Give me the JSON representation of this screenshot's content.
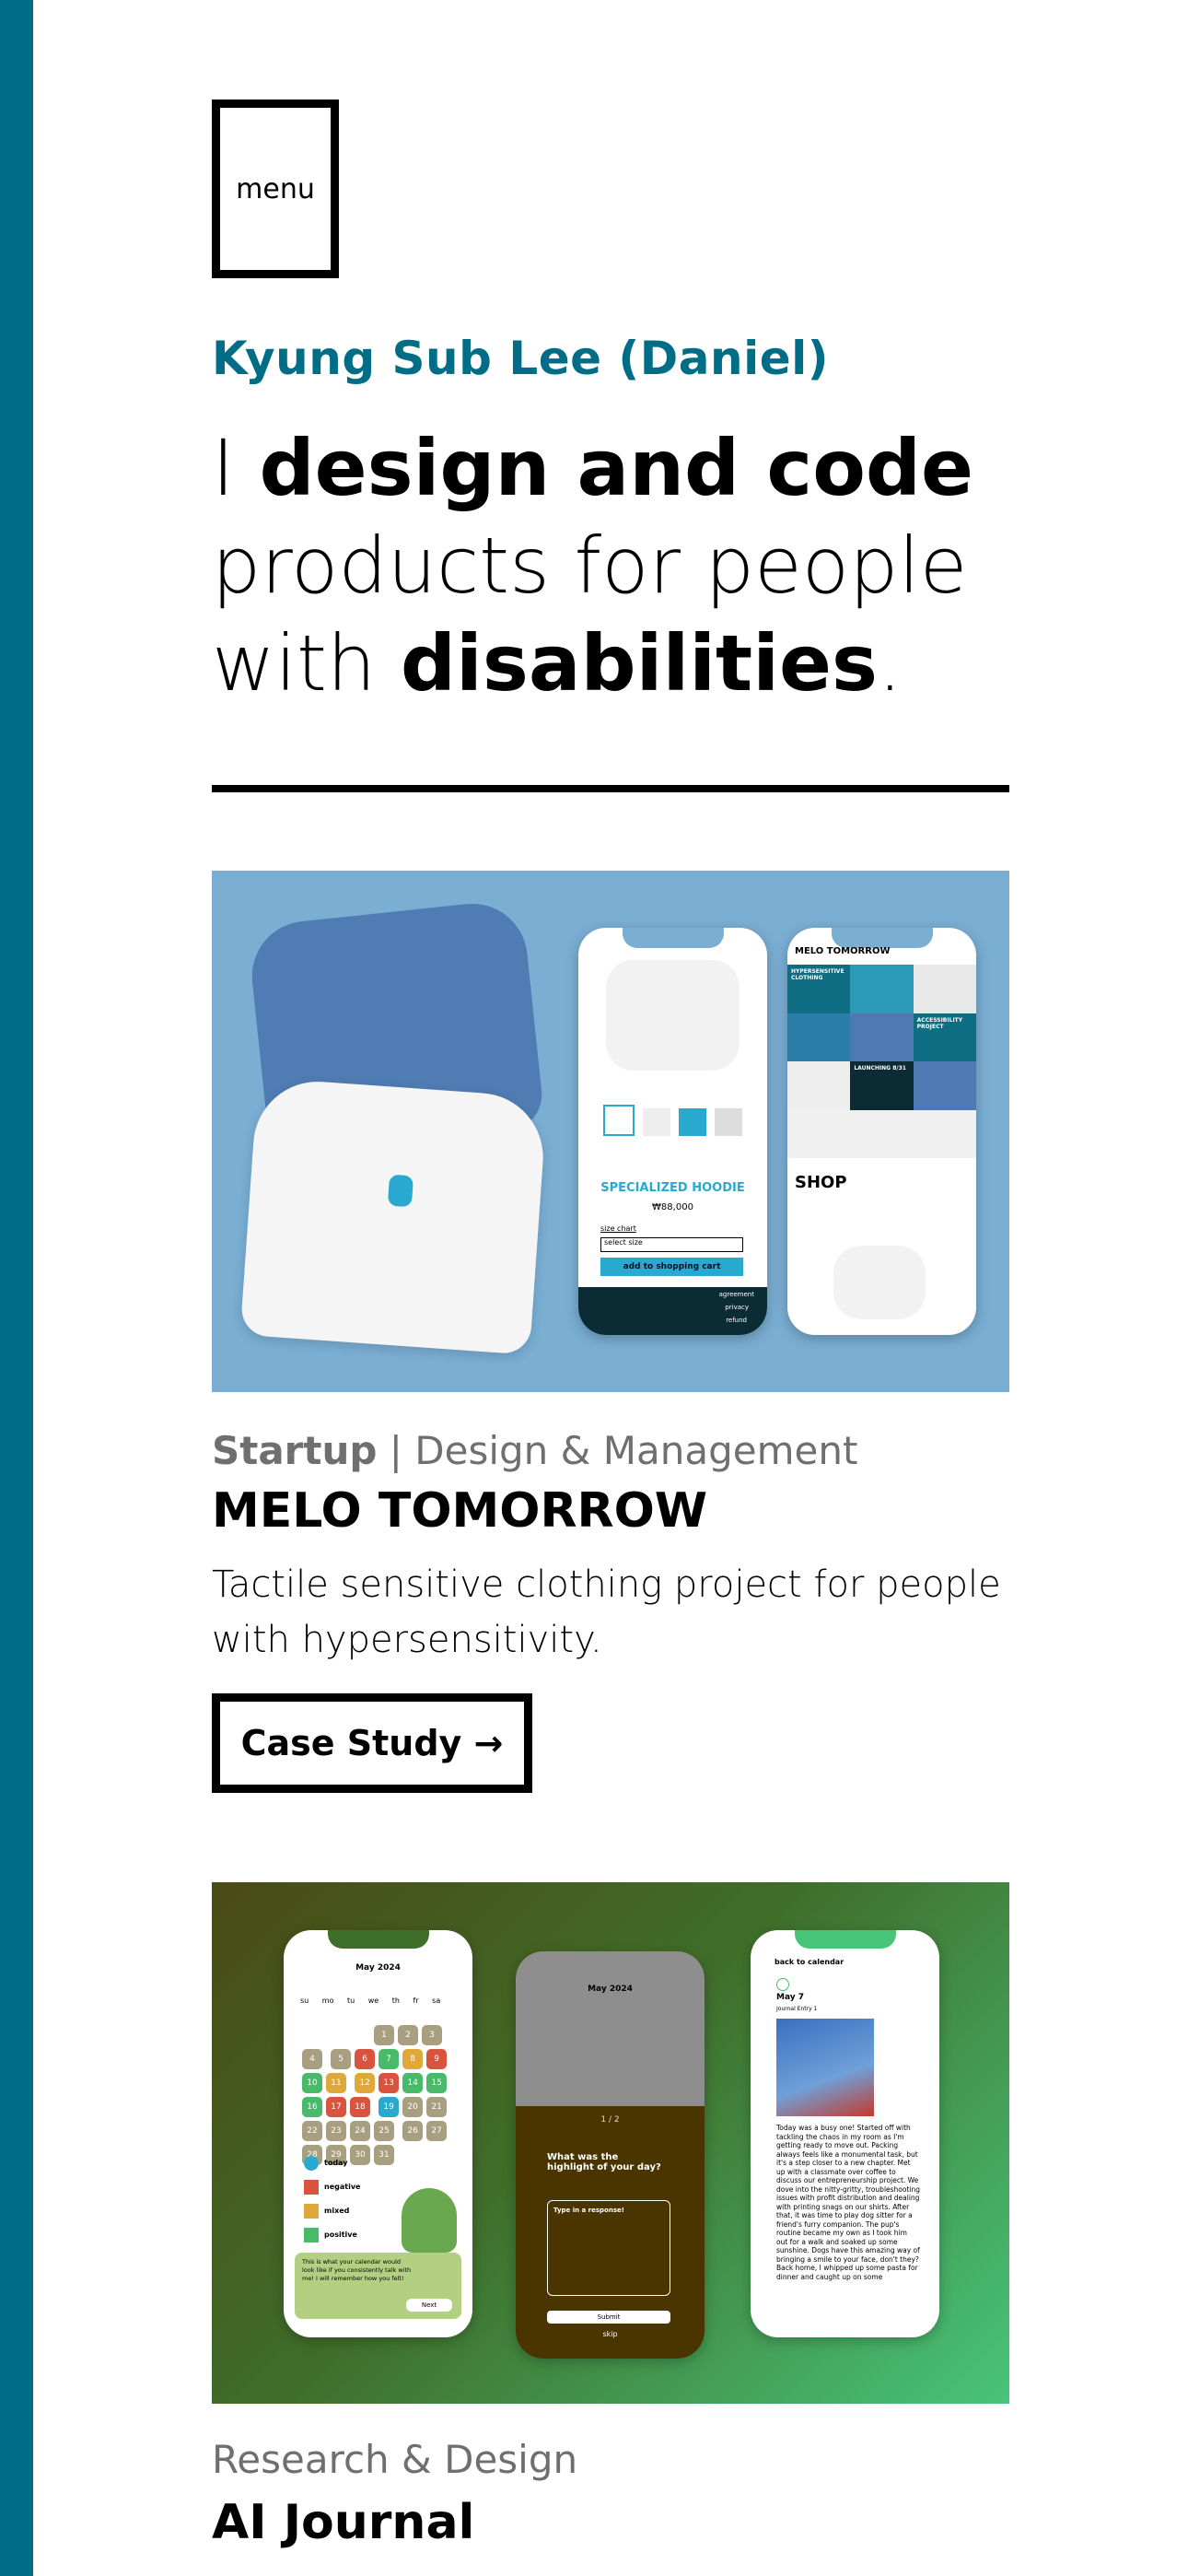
{
  "menu": {
    "label": "menu"
  },
  "hero": {
    "name": "Kyung Sub Lee (Daniel)",
    "headline_pre": "I ",
    "headline_b1": "design and code",
    "headline_mid": " products for people with ",
    "headline_b2": "disabilities",
    "headline_end": "."
  },
  "projects": [
    {
      "category_bold": "Startup",
      "category_rest": " | Design & Management",
      "title": "MELO TOMORROW",
      "description": "Tactile sensitive clothing project for people with hypersensitivity.",
      "cta": "Case Study →",
      "mock": {
        "product_title": "SPECIALIZED HOODIE",
        "price": "₩88,000",
        "size_chart": "size chart",
        "select_size": "select size",
        "add_to_cart": "add to shopping cart",
        "shop_header": "MELO TOMORROW",
        "tile_1": "HYPERSENSITIVE CLOTHING",
        "tile_2": "ACCESSIBILITY PROJECT",
        "tile_3": "LAUNCHING 8/31",
        "shop_label": "SHOP",
        "footer_1": "agreement",
        "footer_2": "privacy",
        "footer_3": "refund"
      }
    },
    {
      "category_rest": "Research & Design",
      "title": "AI Journal",
      "mock": {
        "month": "May 2024",
        "weekdays": [
          "su",
          "mo",
          "tu",
          "we",
          "th",
          "fr",
          "sa"
        ],
        "legend": [
          "today",
          "negative",
          "mixed",
          "positive"
        ],
        "bubble": "This is what your calendar would look like if you consistently talk with me! I will remember how you felt!",
        "next": "Next",
        "progress": "1 / 2",
        "question": "What was the highlight of your day?",
        "input_placeholder": "Type in a response!",
        "submit": "Submit",
        "skip": "skip",
        "back": "back to calendar",
        "entry_date": "May 7",
        "entry_sub": "Journal Entry 1",
        "entry_text": "Today was a busy one! Started off with tackling the chaos in my room as I'm getting ready to move out. Packing always feels like a monumental task, but it's a step closer to a new chapter. Met up with a classmate over coffee to discuss our entrepreneurship project. We dove into the nitty-gritty, troubleshooting issues with profit distribution and dealing with printing snags on our shirts. After that, it was time to play dog sitter for a friend's furry companion. The pup's routine became my own as I took him out for a walk and soaked up some sunshine. Dogs have this amazing way of bringing a smile to your face, don't they? Back home, I whipped up some pasta for dinner and caught up on some"
      }
    }
  ],
  "colors": {
    "accent": "#006d87",
    "melo_bg": "#7aaed3"
  }
}
